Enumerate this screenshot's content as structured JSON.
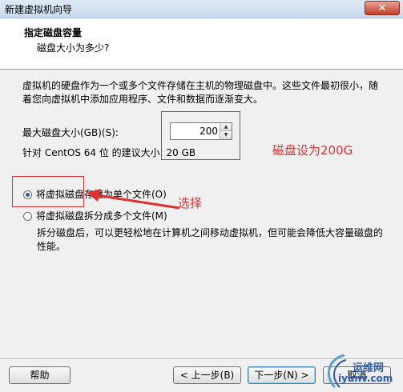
{
  "window": {
    "title": "新建虚拟机向导",
    "close_label": "✕"
  },
  "header": {
    "title": "指定磁盘容量",
    "subtitle": "磁盘大小为多少?"
  },
  "description": "虚拟机的硬盘作为一个或多个文件存储在主机的物理磁盘中。这些文件最初很小，随着您向虚拟机中添加应用程序、文件和数据而逐渐变大。",
  "disk_size": {
    "label": "最大磁盘大小(GB)(S):",
    "value": "200",
    "recommended": "针对 CentOS 64 位 的建议大小: 20 GB"
  },
  "options": [
    {
      "label": "将虚拟磁盘存储为单个文件(O)",
      "selected": true
    },
    {
      "label": "将虚拟磁盘拆分成多个文件(M)",
      "selected": false
    }
  ],
  "split_description": "拆分磁盘后，可以更轻松地在计算机之间移动虚拟机，但可能会降低大容量磁盘的性能。",
  "annotations": {
    "disk_note": "磁盘设为200G",
    "choose_note": "选择",
    "color": "#e03030"
  },
  "buttons": {
    "help": "帮助",
    "back": "< 上一步(B)",
    "next": "下一步(N) >",
    "cancel": "取消"
  },
  "watermark": {
    "text1": "运维网",
    "text2": "iyunv.com"
  }
}
